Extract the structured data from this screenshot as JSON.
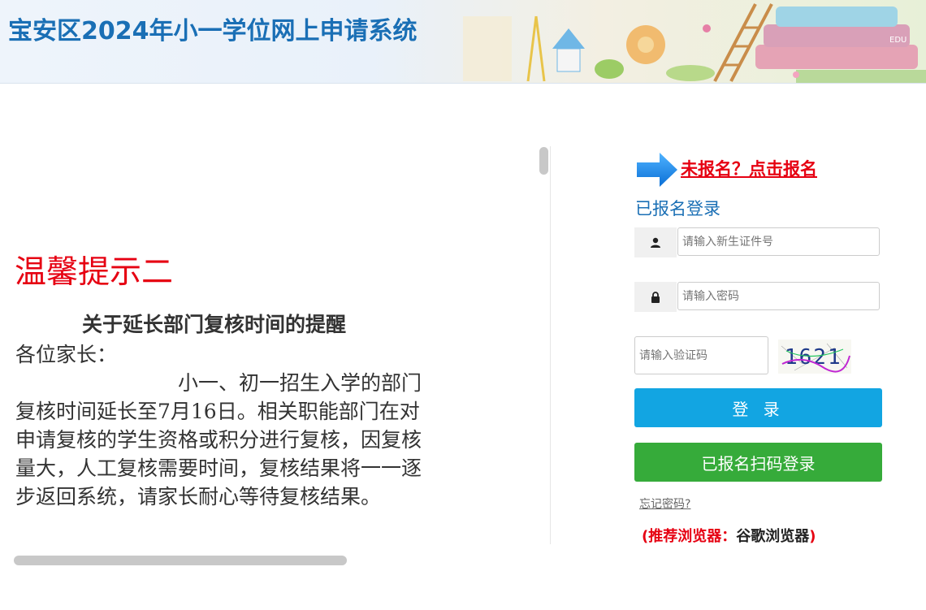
{
  "header": {
    "title": "宝安区2024年小一学位网上申请系统"
  },
  "notice": {
    "title": "温馨提示二",
    "heading": "关于延长部门复核时间的提醒",
    "greeting": "各位家长：",
    "paragraph": "小一、初一招生入学的部门复核时间延长至7月16日。相关职能部门在对申请复核的学生资格或积分进行复核，因复核量大，人工复核需要时间，复核结果将一一逐步返回系统，请家长耐心等待复核结果。"
  },
  "login": {
    "signup_link": "未报名？点击报名",
    "heading": "已报名登录",
    "id_placeholder": "请输入新生证件号",
    "password_placeholder": "请输入密码",
    "captcha_placeholder": "请输入验证码",
    "captcha_text": "1621",
    "login_button": "登 录",
    "qr_login_button": "已报名扫码登录",
    "forgot_password": "忘记密码?",
    "browser_tip_prefix": "(推荐浏览器：",
    "browser_tip_name": "谷歌浏览器",
    "browser_tip_suffix": ")"
  },
  "icons": {
    "user": "user-icon",
    "lock": "lock-icon",
    "arrow": "arrow-right-icon"
  },
  "colors": {
    "brand_blue": "#1a6fb5",
    "notice_red": "#e60012",
    "login_button": "#12a5e2",
    "qr_button": "#36ab3a"
  }
}
